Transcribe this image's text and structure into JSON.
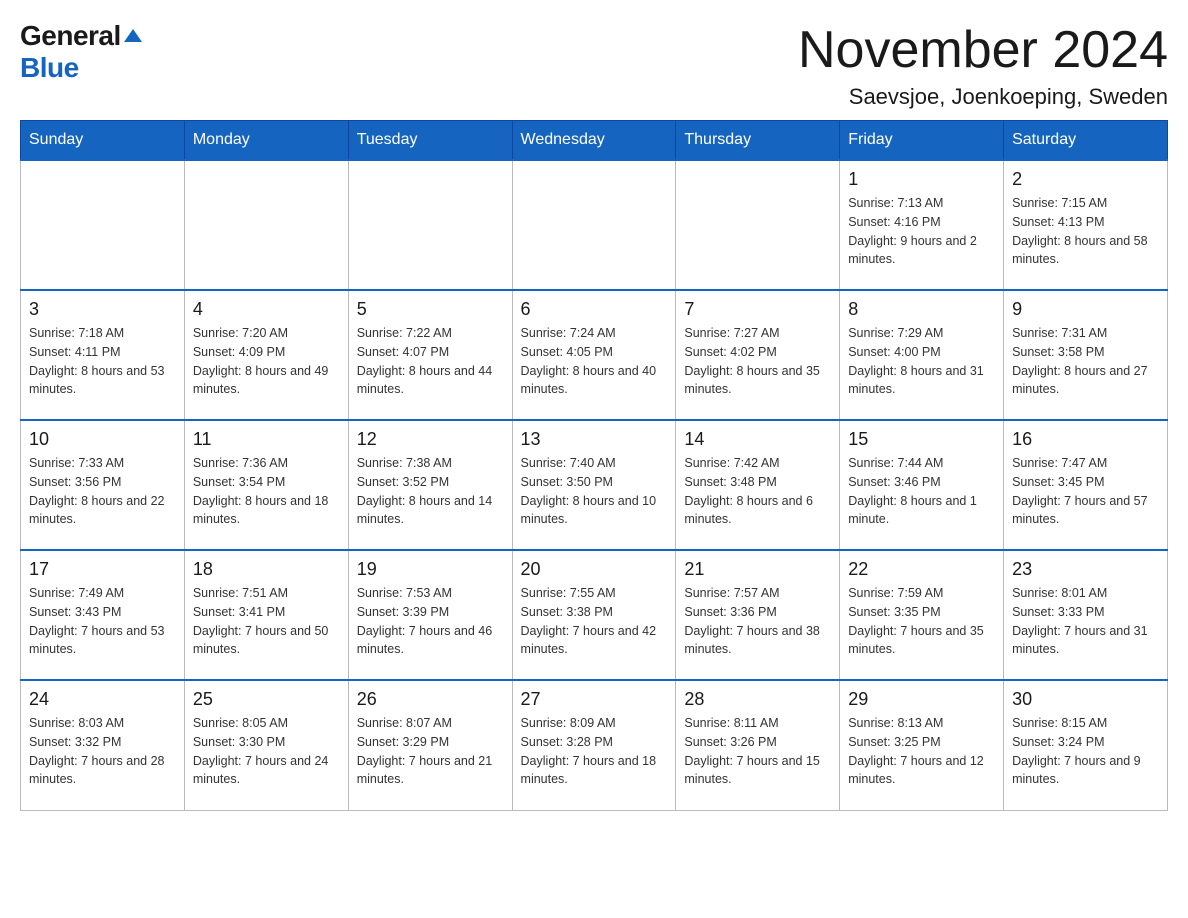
{
  "logo": {
    "general": "General",
    "blue": "Blue"
  },
  "title": "November 2024",
  "location": "Saevsjoe, Joenkoeping, Sweden",
  "days_of_week": [
    "Sunday",
    "Monday",
    "Tuesday",
    "Wednesday",
    "Thursday",
    "Friday",
    "Saturday"
  ],
  "weeks": [
    [
      {
        "day": "",
        "info": ""
      },
      {
        "day": "",
        "info": ""
      },
      {
        "day": "",
        "info": ""
      },
      {
        "day": "",
        "info": ""
      },
      {
        "day": "",
        "info": ""
      },
      {
        "day": "1",
        "info": "Sunrise: 7:13 AM\nSunset: 4:16 PM\nDaylight: 9 hours and 2 minutes."
      },
      {
        "day": "2",
        "info": "Sunrise: 7:15 AM\nSunset: 4:13 PM\nDaylight: 8 hours and 58 minutes."
      }
    ],
    [
      {
        "day": "3",
        "info": "Sunrise: 7:18 AM\nSunset: 4:11 PM\nDaylight: 8 hours and 53 minutes."
      },
      {
        "day": "4",
        "info": "Sunrise: 7:20 AM\nSunset: 4:09 PM\nDaylight: 8 hours and 49 minutes."
      },
      {
        "day": "5",
        "info": "Sunrise: 7:22 AM\nSunset: 4:07 PM\nDaylight: 8 hours and 44 minutes."
      },
      {
        "day": "6",
        "info": "Sunrise: 7:24 AM\nSunset: 4:05 PM\nDaylight: 8 hours and 40 minutes."
      },
      {
        "day": "7",
        "info": "Sunrise: 7:27 AM\nSunset: 4:02 PM\nDaylight: 8 hours and 35 minutes."
      },
      {
        "day": "8",
        "info": "Sunrise: 7:29 AM\nSunset: 4:00 PM\nDaylight: 8 hours and 31 minutes."
      },
      {
        "day": "9",
        "info": "Sunrise: 7:31 AM\nSunset: 3:58 PM\nDaylight: 8 hours and 27 minutes."
      }
    ],
    [
      {
        "day": "10",
        "info": "Sunrise: 7:33 AM\nSunset: 3:56 PM\nDaylight: 8 hours and 22 minutes."
      },
      {
        "day": "11",
        "info": "Sunrise: 7:36 AM\nSunset: 3:54 PM\nDaylight: 8 hours and 18 minutes."
      },
      {
        "day": "12",
        "info": "Sunrise: 7:38 AM\nSunset: 3:52 PM\nDaylight: 8 hours and 14 minutes."
      },
      {
        "day": "13",
        "info": "Sunrise: 7:40 AM\nSunset: 3:50 PM\nDaylight: 8 hours and 10 minutes."
      },
      {
        "day": "14",
        "info": "Sunrise: 7:42 AM\nSunset: 3:48 PM\nDaylight: 8 hours and 6 minutes."
      },
      {
        "day": "15",
        "info": "Sunrise: 7:44 AM\nSunset: 3:46 PM\nDaylight: 8 hours and 1 minute."
      },
      {
        "day": "16",
        "info": "Sunrise: 7:47 AM\nSunset: 3:45 PM\nDaylight: 7 hours and 57 minutes."
      }
    ],
    [
      {
        "day": "17",
        "info": "Sunrise: 7:49 AM\nSunset: 3:43 PM\nDaylight: 7 hours and 53 minutes."
      },
      {
        "day": "18",
        "info": "Sunrise: 7:51 AM\nSunset: 3:41 PM\nDaylight: 7 hours and 50 minutes."
      },
      {
        "day": "19",
        "info": "Sunrise: 7:53 AM\nSunset: 3:39 PM\nDaylight: 7 hours and 46 minutes."
      },
      {
        "day": "20",
        "info": "Sunrise: 7:55 AM\nSunset: 3:38 PM\nDaylight: 7 hours and 42 minutes."
      },
      {
        "day": "21",
        "info": "Sunrise: 7:57 AM\nSunset: 3:36 PM\nDaylight: 7 hours and 38 minutes."
      },
      {
        "day": "22",
        "info": "Sunrise: 7:59 AM\nSunset: 3:35 PM\nDaylight: 7 hours and 35 minutes."
      },
      {
        "day": "23",
        "info": "Sunrise: 8:01 AM\nSunset: 3:33 PM\nDaylight: 7 hours and 31 minutes."
      }
    ],
    [
      {
        "day": "24",
        "info": "Sunrise: 8:03 AM\nSunset: 3:32 PM\nDaylight: 7 hours and 28 minutes."
      },
      {
        "day": "25",
        "info": "Sunrise: 8:05 AM\nSunset: 3:30 PM\nDaylight: 7 hours and 24 minutes."
      },
      {
        "day": "26",
        "info": "Sunrise: 8:07 AM\nSunset: 3:29 PM\nDaylight: 7 hours and 21 minutes."
      },
      {
        "day": "27",
        "info": "Sunrise: 8:09 AM\nSunset: 3:28 PM\nDaylight: 7 hours and 18 minutes."
      },
      {
        "day": "28",
        "info": "Sunrise: 8:11 AM\nSunset: 3:26 PM\nDaylight: 7 hours and 15 minutes."
      },
      {
        "day": "29",
        "info": "Sunrise: 8:13 AM\nSunset: 3:25 PM\nDaylight: 7 hours and 12 minutes."
      },
      {
        "day": "30",
        "info": "Sunrise: 8:15 AM\nSunset: 3:24 PM\nDaylight: 7 hours and 9 minutes."
      }
    ]
  ]
}
